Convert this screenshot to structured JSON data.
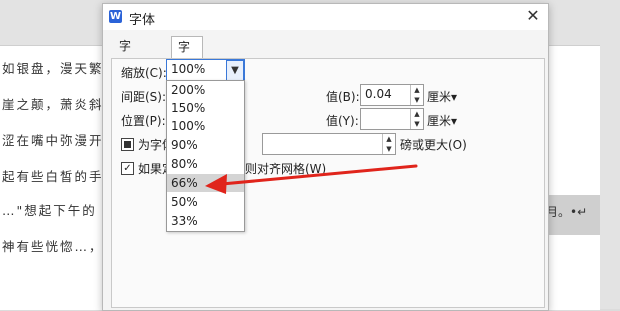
{
  "document": {
    "lines": [
      "如银盘，漫天繁",
      "崖之颠，萧炎斜",
      "涩在嘴中弥漫开",
      "起有些白皙的手",
      "…\"想起下午的",
      "神有些恍惚…，"
    ],
    "tail_text": "月。•↵"
  },
  "dialog": {
    "app_icon": "W",
    "title": "字体",
    "close_glyph": "✕",
    "tabs": [
      {
        "label": "字体(N)"
      },
      {
        "label": "字符间距(R)"
      }
    ],
    "scale": {
      "label": "缩放(C):",
      "value": "100%"
    },
    "spacing": {
      "label": "间距(S):",
      "value_label": "值(B):",
      "value": "0.04",
      "unit": "厘米▾"
    },
    "position": {
      "label": "位置(P):",
      "value_label": "值(Y):",
      "value": "",
      "unit": "厘米▾"
    },
    "kerning": {
      "label": "为字体",
      "suffix": "磅或更大(O)",
      "value": ""
    },
    "grid": {
      "label": "如果定",
      "suffix": "则对齐网格(W)"
    },
    "scale_options": [
      "200%",
      "150%",
      "100%",
      "90%",
      "80%",
      "66%",
      "50%",
      "33%"
    ],
    "selected_option": "66%"
  },
  "colors": {
    "arrow": "#e0241b",
    "accent": "#3a78d8"
  }
}
